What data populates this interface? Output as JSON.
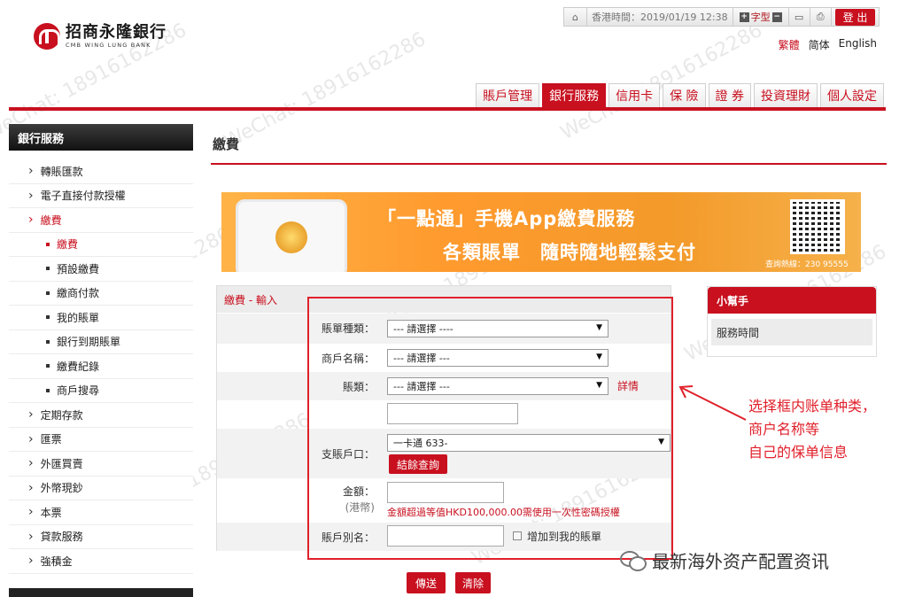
{
  "top_bar": {
    "clock": "香港時間：2019/01/19 12:38",
    "font_label": "字型",
    "font_plus": "+",
    "font_minus": "−",
    "logout": "登 出",
    "icons": [
      "home-icon",
      "folder-icon",
      "printer-icon"
    ]
  },
  "logo": {
    "cn": "招商永隆銀行",
    "en": "CMB WING LUNG BANK"
  },
  "lang": {
    "trad": "繁體",
    "simp": "简体",
    "en": "English"
  },
  "nav": {
    "tabs": [
      "賬戶管理",
      "銀行服務",
      "信用卡",
      "保 險",
      "證 券",
      "投資理財",
      "個人設定"
    ],
    "active": "銀行服務"
  },
  "sidebar": {
    "title": "銀行服務",
    "items": [
      "轉賬匯款",
      "電子直接付款授權",
      "繳費",
      "繳費",
      "預設繳費",
      "繳商付款",
      "我的賬單",
      "銀行到期賬單",
      "繳費紀錄",
      "商戶搜尋",
      "定期存款",
      "匯票",
      "外匯買賣",
      "外幣現鈔",
      "本票",
      "貸款服務",
      "強積金"
    ]
  },
  "page_title": "繳費",
  "banner": {
    "line1": "「一點通」手機App繳費服務",
    "line2": "各類賬單　隨時隨地輕鬆支付",
    "qr_text": "查詢熱線：230 95555"
  },
  "form": {
    "header": "繳費 - 輸入",
    "bill_type": {
      "label": "賬單種類：",
      "value": "--- 請選擇 ----"
    },
    "merchant": {
      "label": "商戶名稱：",
      "value": "--- 請選擇 ---"
    },
    "bill_class": {
      "label": "賬類：",
      "value": "--- 請選擇 ---",
      "details": "詳情"
    },
    "account": {
      "label": "支賬戶口：",
      "value": "一卡通 633-",
      "query_btn": "結餘查詢"
    },
    "amount": {
      "label": "金額：",
      "currency": "(港幣)",
      "hint": "金額超過等值HKD100,000.00需使用一次性密碼授權"
    },
    "alias": {
      "label": "賬戶別名：",
      "add_text": "增加到我的賬單"
    }
  },
  "buttons": {
    "send": "傳送",
    "clear": "清除"
  },
  "helper": {
    "title": "小幫手",
    "item": "服務時間"
  },
  "annotation": {
    "line1": "选择框内账单种类，",
    "line2": "商户名称等",
    "line3": "自己的保单信息"
  },
  "source": "最新海外资产配置资讯",
  "watermark": "WeChat: 18916162286",
  "colors": {
    "brand_red": "#c8101f",
    "annotation_red": "#e0202b",
    "banner_orange": "#ff9a2e"
  }
}
